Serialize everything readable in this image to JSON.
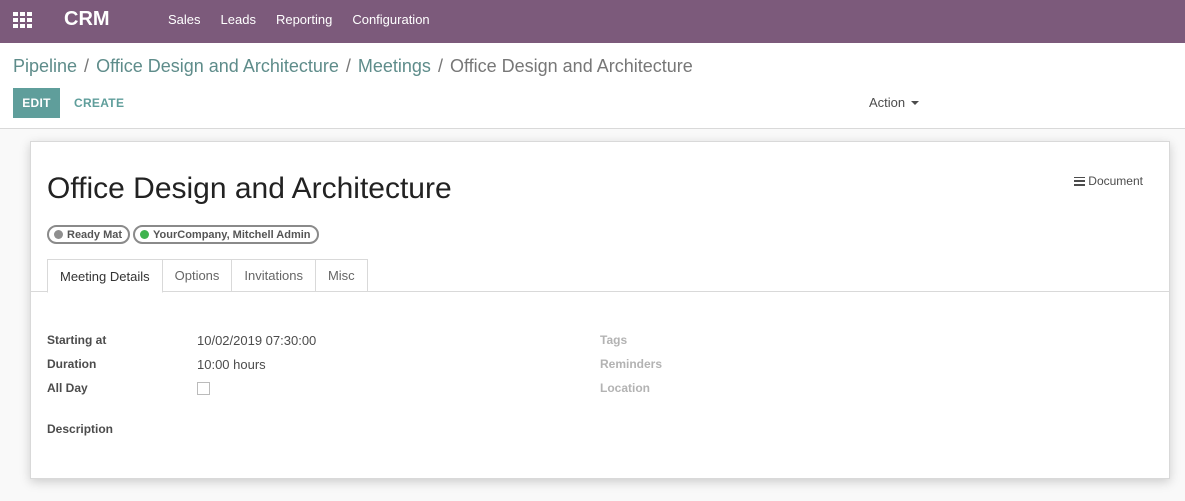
{
  "navbar": {
    "brand": "CRM",
    "menu": [
      "Sales",
      "Leads",
      "Reporting",
      "Configuration"
    ]
  },
  "breadcrumb": {
    "items": [
      "Pipeline",
      "Office Design and Architecture",
      "Meetings"
    ],
    "current": "Office Design and Architecture",
    "separator": "/"
  },
  "toolbar": {
    "edit_label": "EDIT",
    "create_label": "CREATE",
    "action_label": "Action"
  },
  "record": {
    "title": "Office Design and Architecture",
    "document_label": "Document",
    "attendees": [
      {
        "name": "Ready Mat",
        "status_color": "#8f8f8f"
      },
      {
        "name": "YourCompany, Mitchell Admin",
        "status_color": "#3fb34f"
      }
    ]
  },
  "tabs": [
    "Meeting Details",
    "Options",
    "Invitations",
    "Misc"
  ],
  "active_tab": "Meeting Details",
  "fields": {
    "starting_at_label": "Starting at",
    "starting_at_value": "10/02/2019 07:30:00",
    "duration_label": "Duration",
    "duration_value": "10:00 hours",
    "all_day_label": "All Day",
    "all_day_checked": false,
    "tags_label": "Tags",
    "reminders_label": "Reminders",
    "location_label": "Location",
    "description_label": "Description"
  },
  "colors": {
    "navbar": "#7c5a7b",
    "primary": "#5f9e9b",
    "link": "#5e8c8a"
  }
}
